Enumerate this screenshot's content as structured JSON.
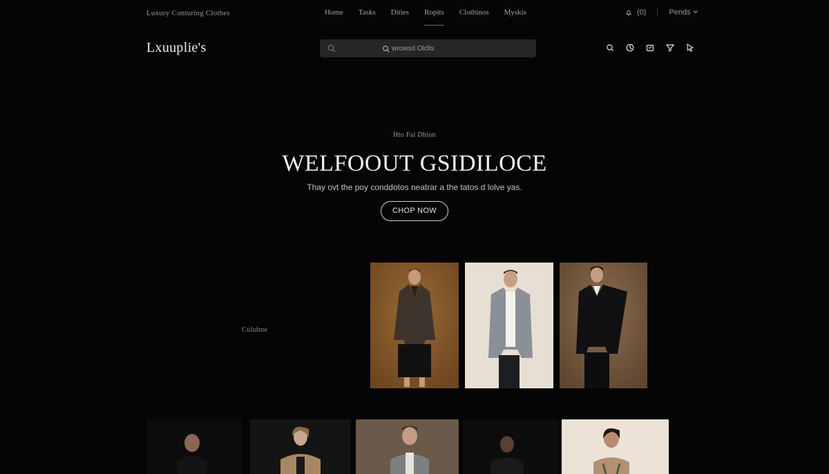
{
  "topbar": {
    "tagline": "Luxury Conturing Clothes",
    "nav": [
      "Home",
      "Tasks",
      "Dities",
      "Ropits",
      "Clothinos",
      "Myskis"
    ],
    "cart_count": "(0)",
    "language": "Pends"
  },
  "header": {
    "logo": "Lxuuplie's",
    "search_placeholder": "wrowsd Olclts"
  },
  "hero": {
    "eyebrow": "Hto Fal Dhion",
    "title": "WELFOOUT GSIDILOCE",
    "subtitle": "Thay ovt the poy conddotos neatrar a the tatos d lolve yas.",
    "cta": "CHOP NOW"
  },
  "featured": {
    "category_label": "Culubne",
    "products": [
      {
        "name": "model-brown-overshirt",
        "bg": "#8a5a2b"
      },
      {
        "name": "model-grey-jacket",
        "bg": "#e6ddd2"
      },
      {
        "name": "model-black-suit",
        "bg": "#7a5e44"
      }
    ]
  },
  "gallery": {
    "products": [
      {
        "name": "model-black-top",
        "bg": "#111111"
      },
      {
        "name": "model-beige-coat",
        "bg": "#1a1a1a"
      },
      {
        "name": "model-grey-blazer",
        "bg": "#6a5a4a"
      },
      {
        "name": "model-dark-portrait",
        "bg": "#0d0d0d"
      },
      {
        "name": "model-cream-portrait",
        "bg": "#ece2d4"
      }
    ]
  },
  "colors": {
    "background": "#050505",
    "search_bg": "#262626",
    "text_primary": "#f4f0ea",
    "text_muted": "#9d978f"
  }
}
